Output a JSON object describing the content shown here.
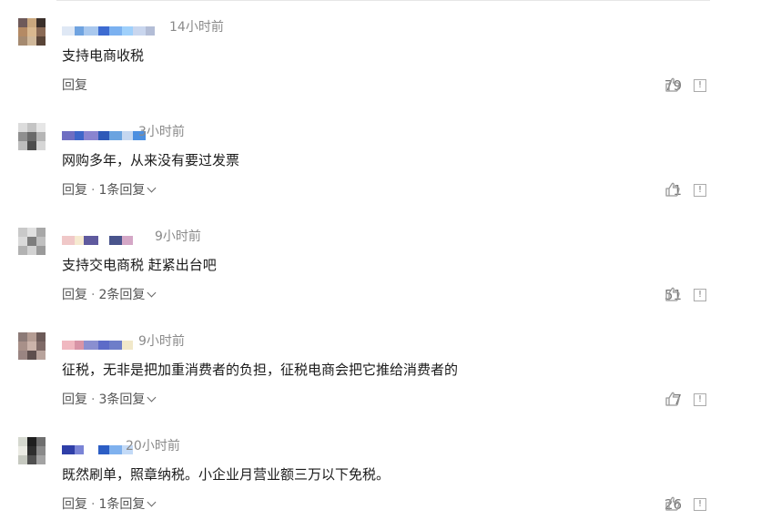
{
  "comments": [
    {
      "time": "14小时前",
      "text": "支持电商收税",
      "reply_label": "回复",
      "replies_label": "",
      "likes": "79",
      "avatar_colors": [
        "#6e5a5a",
        "#c9a77e",
        "#3a2f2a",
        "#b48a64",
        "#d9b88f",
        "#8a6a55",
        "#a58a70",
        "#d0b89a",
        "#5a4538"
      ],
      "name_colors": [
        "#dfe8f5",
        "#6fa3e0",
        "#a9c8ee",
        "#3d6bd1",
        "#7bb1f0",
        "#9fd0fb",
        "#c9d6ee",
        "#b3bdd6"
      ]
    },
    {
      "time": "3小时前",
      "text": "网购多年，从来没有要过发票",
      "reply_label": "回复",
      "replies_label": "1条回复",
      "likes": "1",
      "avatar_colors": [
        "#dcdcdc",
        "#c4c4c4",
        "#e6e6e6",
        "#8f8f8f",
        "#6a6a6a",
        "#b5b5b5",
        "#bdbdbd",
        "#4d4d4d",
        "#d6d6d6"
      ],
      "name_colors": [
        "#6f6ec2",
        "#3e66c9",
        "#8a84d0",
        "#2f5ab8",
        "#6aa3e0",
        "#c5d7f0",
        "#4c8fe0"
      ]
    },
    {
      "time": "9小时前",
      "text": "支持交电商税 赶紧出台吧",
      "reply_label": "回复",
      "replies_label": "2条回复",
      "likes": "51",
      "avatar_colors": [
        "#c9c9c9",
        "#e0e0e0",
        "#a8a8a8",
        "#dadada",
        "#7e7e7e",
        "#c0c0c0",
        "#b2b2b2",
        "#d2d2d2",
        "#9a9a9a"
      ],
      "name_colors": [
        "#f0c8c8",
        "#f6ead0",
        "#5f5a9e",
        "#ffffff",
        "#49548c",
        "#d4a7c6"
      ]
    },
    {
      "time": "9小时前",
      "text": "征税，无非是把加重消费者的负担，征税电商会把它推给消费者的",
      "reply_label": "回复",
      "replies_label": "3条回复",
      "likes": "7",
      "avatar_colors": [
        "#8c7a77",
        "#b49c93",
        "#6c5a58",
        "#a89089",
        "#cbb3aa",
        "#7f6a67",
        "#9a8582",
        "#5e4f4e",
        "#b8a39c"
      ],
      "name_colors": [
        "#f0b8c0",
        "#d894a6",
        "#8a8fd0",
        "#5d6bc8",
        "#6e7ec9",
        "#f1e8c9"
      ]
    },
    {
      "time": "20小时前",
      "text": "既然刷单，照章纳税。小企业月营业额三万以下免税。",
      "reply_label": "回复",
      "replies_label": "1条回复",
      "likes": "26",
      "avatar_colors": [
        "#d5d8cf",
        "#1f1f1f",
        "#6f6f6f",
        "#eaeae3",
        "#2e2e2e",
        "#8a8a8a",
        "#c6c9c0",
        "#505050",
        "#a3a3a3"
      ],
      "name_colors": [
        "#2f3fa8",
        "#7a84d6",
        "#ffffff",
        "#2c5ec5",
        "#7fb1ee",
        "#c3daf7"
      ]
    }
  ],
  "icons": {
    "like": "thumbs-up-icon",
    "report": "report-icon"
  },
  "report_glyph": "!"
}
